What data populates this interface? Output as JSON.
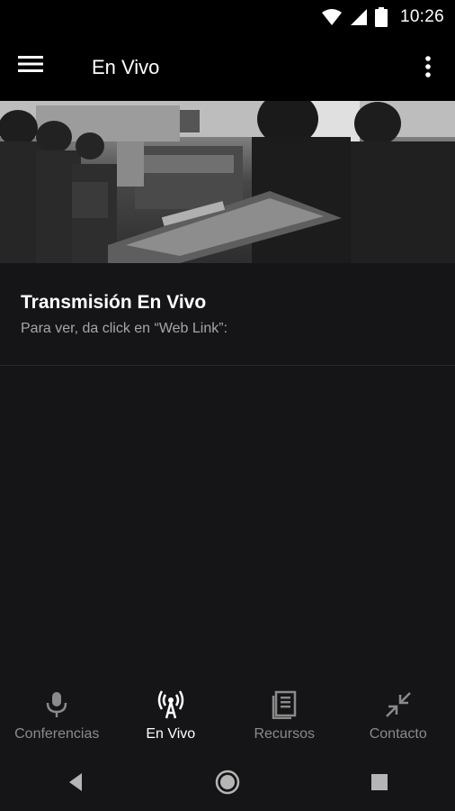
{
  "status_bar": {
    "time": "10:26",
    "icons": [
      "wifi-icon",
      "signal-icon",
      "battery-icon"
    ]
  },
  "app_bar": {
    "title": "En Vivo",
    "menu_icon": "hamburger-menu-icon",
    "more_icon": "more-vert-icon"
  },
  "hero": {
    "description_icon": "live-broadcast-photo"
  },
  "content": {
    "title": "Transmisión En Vivo",
    "subtitle": "Para ver, da click en “Web Link”:"
  },
  "bottom_nav": {
    "items": [
      {
        "label": "Conferencias",
        "icon": "microphone-icon",
        "active": false
      },
      {
        "label": "En Vivo",
        "icon": "broadcast-icon",
        "active": true
      },
      {
        "label": "Recursos",
        "icon": "book-icon",
        "active": false
      },
      {
        "label": "Contacto",
        "icon": "collapse-arrows-icon",
        "active": false
      }
    ]
  },
  "system_nav": {
    "icons": [
      "back-icon",
      "home-icon",
      "recents-icon"
    ]
  },
  "colors": {
    "background": "#151517",
    "bar": "#000000",
    "active": "#ffffff",
    "inactive": "#8a8a8a"
  }
}
